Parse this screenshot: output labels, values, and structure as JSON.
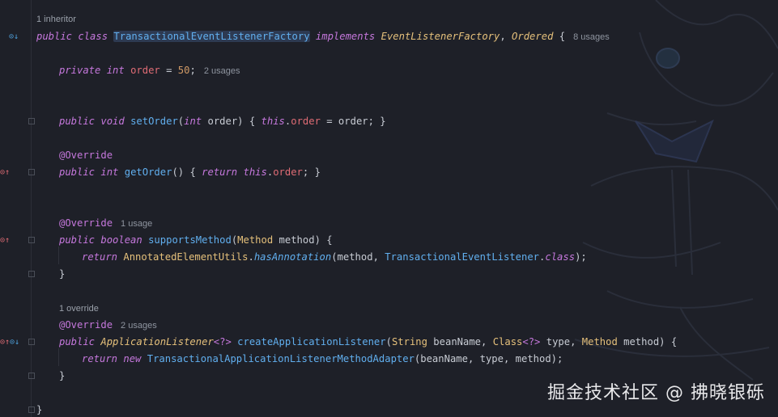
{
  "editor": {
    "inline_hints": {
      "inheritor": "1 inheritor",
      "override": "1 override"
    },
    "code": {
      "class_line": {
        "kw_public": "public",
        "kw_class": "class",
        "class_name": "TransactionalEventListenerFactory",
        "kw_implements": "implements",
        "iface1": "EventListenerFactory",
        "comma": ",",
        "iface2": "Ordered",
        "brace": "{",
        "usages": "8 usages"
      },
      "field_line": {
        "kw_private": "private",
        "kw_int": "int",
        "name": "order",
        "eq": "=",
        "value": "50",
        "semi": ";",
        "usages": "2 usages"
      },
      "setorder_line": {
        "kw_public": "public",
        "kw_void": "void",
        "name": "setOrder",
        "params_open": "(",
        "p_type": "int",
        "p_name": " order",
        "params_close": ") { ",
        "kw_this": "this",
        "dot": ".",
        "field": "order",
        "rest": " = order; }"
      },
      "override1": "@Override",
      "getorder_line": {
        "kw_public": "public",
        "kw_int": "int",
        "name": "getOrder",
        "mid": "() { ",
        "kw_return": "return",
        "kw_this": "this",
        "dot": ".",
        "field": "order",
        "end": "; }"
      },
      "override2": "@Override",
      "override2_usage": "1 usage",
      "supports_line": {
        "kw_public": "public",
        "kw_boolean": "boolean",
        "name": "supportsMethod",
        "open": "(",
        "p_type": "Method",
        "p_name": " method) {"
      },
      "return1_line": {
        "kw_return": "return",
        "util": "AnnotatedElementUtils",
        "dot": ".",
        "method": "hasAnnotation",
        "args_a": "(method, ",
        "arg_cls": "TransactionalEventListener",
        "dot2": ".",
        "kw_class": "class",
        "end": ");"
      },
      "close1": "}",
      "override3": "@Override",
      "override3_usage": "2 usages",
      "create_line": {
        "kw_public": "public",
        "ret_type": "ApplicationListener",
        "generic": "<?>",
        "name": "createApplicationListener",
        "open": "(",
        "t1": "String",
        "n1": " beanName, ",
        "t2": "Class",
        "g2": "<?>",
        "n2": " type, ",
        "t3": "Method",
        "n3": " method) {"
      },
      "return2_line": {
        "kw_return": "return",
        "kw_new": "new",
        "cls": "TransactionalApplicationListenerMethodAdapter",
        "args": "(beanName, type, method);"
      },
      "close2": "}",
      "close_class": "}"
    },
    "watermark": "掘金技术社区 @ 拂晓银砾",
    "colors": {
      "background": "#1e2028",
      "keyword": "#c678dd",
      "class_name": "#61afef",
      "interface": "#e5c07b",
      "field": "#e06c75",
      "number": "#d19a66"
    },
    "icons": [
      "implement-marker-icon",
      "override-marker-icon",
      "fold-icon"
    ]
  }
}
